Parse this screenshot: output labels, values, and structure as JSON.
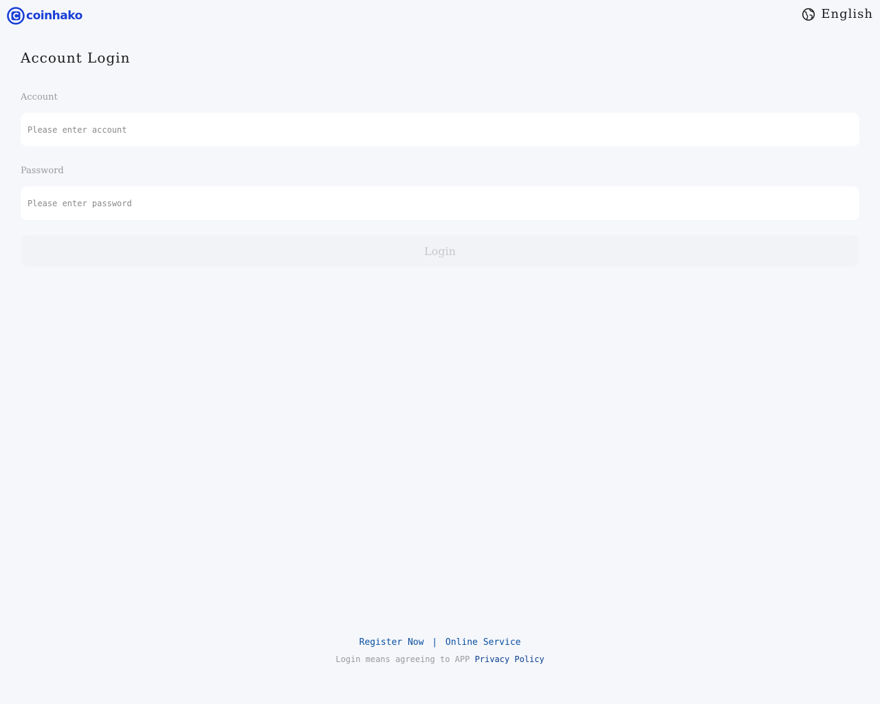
{
  "header": {
    "logo_text": "coinhako",
    "language_label": "English",
    "brand_color": "#1a3fd6"
  },
  "login": {
    "title": "Account Login",
    "account_label": "Account",
    "account_placeholder": "Please enter account",
    "account_value": "",
    "password_label": "Password",
    "password_placeholder": "Please enter password",
    "password_value": "",
    "login_button": "Login"
  },
  "footer": {
    "register_link": "Register Now",
    "separator": "|",
    "service_link": "Online Service",
    "policy_prefix": "Login means agreeing to APP ",
    "policy_link": "Privacy Policy"
  }
}
